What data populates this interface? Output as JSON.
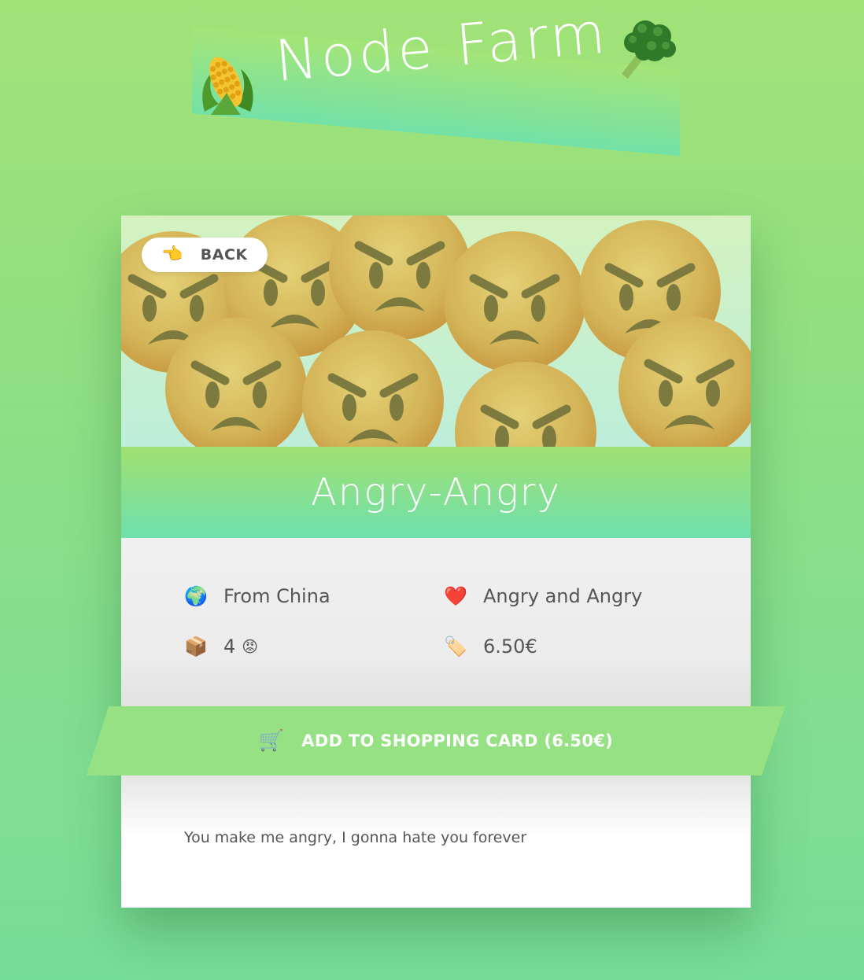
{
  "header": {
    "title": "Node Farm",
    "left_icon": "corn-icon",
    "right_icon": "broccoli-icon"
  },
  "product": {
    "back_label": "BACK",
    "back_icon": "pointing-hand-icon",
    "name": "Angry-Angry",
    "hero_image": "angry-face-emoji-pattern",
    "from": "From China",
    "nutrients": "Angry and Angry",
    "quantity": "4",
    "price": "6.50€",
    "cart_label": "ADD TO SHOPPING CARD (6.50€)",
    "description": "You make me angry, I gonna hate you forever"
  },
  "colors": {
    "background_top": "#a1e277",
    "background_bottom": "#77dd9a",
    "title_band_top": "#a0e070",
    "title_band_bottom": "#6fe0ae",
    "cart_button": "#95e184",
    "text": "#555555"
  }
}
